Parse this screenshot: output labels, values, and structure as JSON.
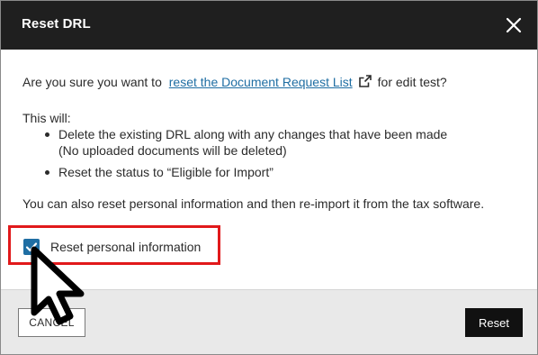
{
  "dialog": {
    "title": "Reset DRL"
  },
  "content": {
    "question_prefix": "Are you sure you want to",
    "question_link": "reset the Document Request List",
    "question_suffix": "for edit test?",
    "this_will": "This will:",
    "bullets": [
      {
        "line1": "Delete the existing DRL along with any changes that have been made",
        "line2": "(No uploaded documents will be deleted)"
      },
      {
        "line1": "Reset the status to “Eligible for Import”",
        "line2": ""
      }
    ],
    "also_text": "You can also reset personal information and then re-import it from the tax software."
  },
  "checkbox": {
    "label": "Reset personal information",
    "checked": true
  },
  "footer": {
    "cancel_label": "CANCEL",
    "reset_label": "Reset"
  },
  "colors": {
    "header_bg": "#1f1f1f",
    "link": "#1f6ea3",
    "checkbox": "#1f6ea3",
    "highlight": "#e1191b",
    "primary_button": "#111111"
  },
  "icons": {
    "close": "close-icon",
    "external_link": "external-link-icon",
    "check": "checkmark-icon",
    "cursor": "mouse-pointer-icon"
  }
}
